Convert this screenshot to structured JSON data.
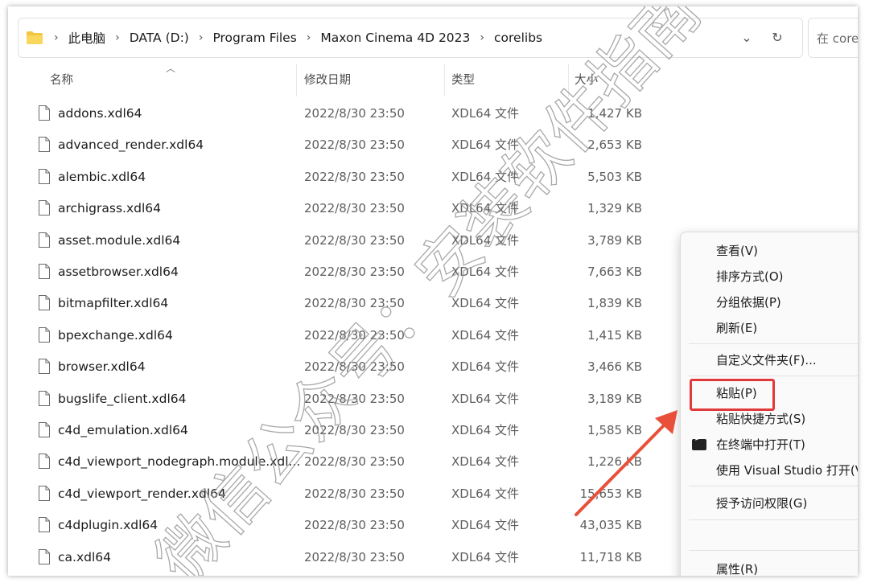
{
  "breadcrumbs": [
    "此电脑",
    "DATA (D:)",
    "Program Files",
    "Maxon Cinema 4D 2023",
    "corelibs"
  ],
  "search_placeholder": "在 core",
  "columns": {
    "name": "名称",
    "date": "修改日期",
    "type": "类型",
    "size": "大小"
  },
  "files": [
    {
      "name": "addons.xdl64",
      "date": "2022/8/30 23:50",
      "type": "XDL64 文件",
      "size": "1,427 KB"
    },
    {
      "name": "advanced_render.xdl64",
      "date": "2022/8/30 23:50",
      "type": "XDL64 文件",
      "size": "2,653 KB"
    },
    {
      "name": "alembic.xdl64",
      "date": "2022/8/30 23:50",
      "type": "XDL64 文件",
      "size": "5,503 KB"
    },
    {
      "name": "archigrass.xdl64",
      "date": "2022/8/30 23:50",
      "type": "XDL64 文件",
      "size": "1,329 KB"
    },
    {
      "name": "asset.module.xdl64",
      "date": "2022/8/30 23:50",
      "type": "XDL64 文件",
      "size": "3,789 KB"
    },
    {
      "name": "assetbrowser.xdl64",
      "date": "2022/8/30 23:50",
      "type": "XDL64 文件",
      "size": "7,663 KB"
    },
    {
      "name": "bitmapfilter.xdl64",
      "date": "2022/8/30 23:50",
      "type": "XDL64 文件",
      "size": "1,839 KB"
    },
    {
      "name": "bpexchange.xdl64",
      "date": "2022/8/30 23:50",
      "type": "XDL64 文件",
      "size": "1,415 KB"
    },
    {
      "name": "browser.xdl64",
      "date": "2022/8/30 23:50",
      "type": "XDL64 文件",
      "size": "3,466 KB"
    },
    {
      "name": "bugslife_client.xdl64",
      "date": "2022/8/30 23:50",
      "type": "XDL64 文件",
      "size": "3,189 KB"
    },
    {
      "name": "c4d_emulation.xdl64",
      "date": "2022/8/30 23:50",
      "type": "XDL64 文件",
      "size": "1,585 KB"
    },
    {
      "name": "c4d_viewport_nodegraph.module.xdl...",
      "date": "2022/8/30 23:50",
      "type": "XDL64 文件",
      "size": "1,226 KB"
    },
    {
      "name": "c4d_viewport_render.xdl64",
      "date": "2022/8/30 23:50",
      "type": "XDL64 文件",
      "size": "15,653 KB"
    },
    {
      "name": "c4dplugin.xdl64",
      "date": "2022/8/30 23:50",
      "type": "XDL64 文件",
      "size": "43,035 KB"
    },
    {
      "name": "ca.xdl64",
      "date": "2022/8/30 23:50",
      "type": "XDL64 文件",
      "size": "11,718 KB"
    }
  ],
  "context_menu": {
    "view": "查看(V)",
    "sort": "排序方式(O)",
    "group": "分组依据(P)",
    "refresh": "刷新(E)",
    "customize": "自定义文件夹(F)...",
    "paste": "粘贴(P)",
    "paste_shortcut": "粘贴快捷方式(S)",
    "open_terminal": "在终端中打开(T)",
    "open_vs": "使用 Visual Studio 打开(V",
    "grant_access": "授予访问权限(G)",
    "properties": "属性(R)"
  },
  "watermark": "微信公众号：安装软件指南",
  "colors": {
    "highlight": "#e03a3a",
    "arrow": "#e8503a",
    "folder": "#f4c542"
  }
}
